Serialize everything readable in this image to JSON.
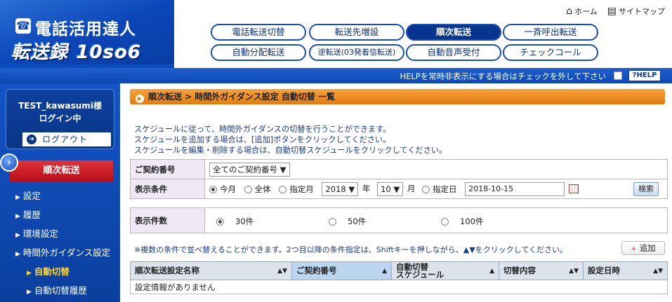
{
  "brand": {
    "top": "電話活用達人",
    "main": "転送録",
    "sub": "10so6"
  },
  "util": {
    "home": "ホーム",
    "sitemap": "サイトマップ"
  },
  "nav": [
    {
      "label": "電話転送切替",
      "active": false
    },
    {
      "label": "転送先増設",
      "active": false
    },
    {
      "label": "順次転送",
      "active": true
    },
    {
      "label": "一斉呼出転送",
      "active": false
    },
    {
      "label": "自動分配転送",
      "active": false
    },
    {
      "label": "逆転送(03発着信転送)",
      "active": false
    },
    {
      "label": "自動音声受付",
      "active": false
    },
    {
      "label": "チェックコール",
      "active": false
    }
  ],
  "help": {
    "text": "HELPを常時非表示にする場合はチェックを外して下さい",
    "button": "?HELP"
  },
  "sidebar": {
    "user": "TEST_kawasumi様",
    "status": "ログイン中",
    "logout": "ログアウト",
    "section": "順次転送",
    "items": [
      {
        "label": "設定"
      },
      {
        "label": "履歴"
      },
      {
        "label": "環境設定"
      },
      {
        "label": "時間外ガイダンス設定"
      },
      {
        "label": "自動切替"
      },
      {
        "label": "自動切替履歴"
      }
    ]
  },
  "main": {
    "breadcrumb": "順次転送 > 時間外ガイダンス設定 自動切替 一覧",
    "intro": [
      "スケジュールに従って、時間外ガイダンスの切替を行うことができます。",
      "スケジュールを追加する場合は、[追加]ボタンをクリックしてください。",
      "スケジュールを編集・削除する場合は、自動切替スケジュールをクリックしてください。"
    ],
    "contract": {
      "label": "ご契約番号",
      "value": "全てのご契約番号"
    },
    "display": {
      "label": "表示条件",
      "opt_month": "今月",
      "opt_all": "全体",
      "opt_spec_month": "指定月",
      "year": "2018",
      "year_unit": "年",
      "month": "10",
      "month_unit": "月",
      "opt_spec_day": "指定日",
      "date": "2018-10-15",
      "search": "検索"
    },
    "count": {
      "label": "表示件数",
      "opt1": "30件",
      "opt2": "50件",
      "opt3": "100件"
    },
    "note": "※複数の条件で並べ替えることができます。2つ目以降の条件指定は、Shiftキーを押しながら、▲▼をクリックしてください。",
    "add": "追加",
    "table": {
      "headers": [
        "順次転送設定名称",
        "ご契約番号",
        "自動切替\nスケジュール",
        "切替内容",
        "設定日時"
      ],
      "empty": "設定情報がありません"
    }
  }
}
